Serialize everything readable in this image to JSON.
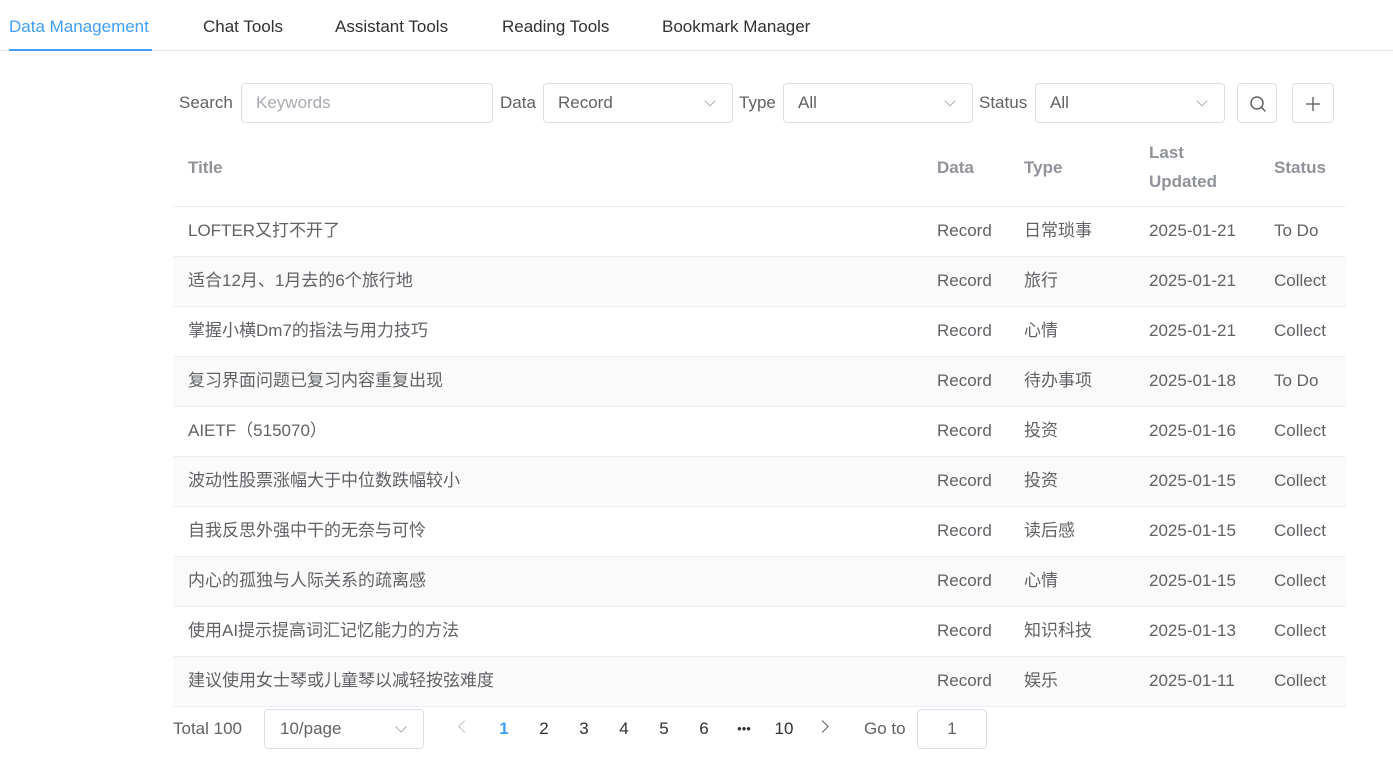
{
  "tabs": [
    {
      "label": "Data Management",
      "active": true
    },
    {
      "label": "Chat Tools",
      "active": false
    },
    {
      "label": "Assistant Tools",
      "active": false
    },
    {
      "label": "Reading Tools",
      "active": false
    },
    {
      "label": "Bookmark Manager",
      "active": false
    }
  ],
  "filters": {
    "search_label": "Search",
    "search_placeholder": "Keywords",
    "search_value": "",
    "data_label": "Data",
    "data_value": "Record",
    "type_label": "Type",
    "type_value": "All",
    "status_label": "Status",
    "status_value": "All",
    "search_button_icon": "search-icon",
    "add_button_icon": "plus-icon"
  },
  "table": {
    "columns": {
      "title": "Title",
      "data": "Data",
      "type": "Type",
      "updated_line1": "Last",
      "updated_line2": "Updated",
      "status": "Status"
    },
    "rows": [
      {
        "title": "LOFTER又打不开了",
        "data": "Record",
        "type": "日常琐事",
        "updated": "2025-01-21",
        "status": "To Do"
      },
      {
        "title": "适合12月、1月去的6个旅行地",
        "data": "Record",
        "type": "旅行",
        "updated": "2025-01-21",
        "status": "Collect"
      },
      {
        "title": "掌握小横Dm7的指法与用力技巧",
        "data": "Record",
        "type": "心情",
        "updated": "2025-01-21",
        "status": "Collect"
      },
      {
        "title": "复习界面问题已复习内容重复出现",
        "data": "Record",
        "type": "待办事项",
        "updated": "2025-01-18",
        "status": "To Do"
      },
      {
        "title": "AIETF（515070）",
        "data": "Record",
        "type": "投资",
        "updated": "2025-01-16",
        "status": "Collect"
      },
      {
        "title": "波动性股票涨幅大于中位数跌幅较小",
        "data": "Record",
        "type": "投资",
        "updated": "2025-01-15",
        "status": "Collect"
      },
      {
        "title": "自我反思外强中干的无奈与可怜",
        "data": "Record",
        "type": "读后感",
        "updated": "2025-01-15",
        "status": "Collect"
      },
      {
        "title": "内心的孤独与人际关系的疏离感",
        "data": "Record",
        "type": "心情",
        "updated": "2025-01-15",
        "status": "Collect"
      },
      {
        "title": "使用AI提示提高词汇记忆能力的方法",
        "data": "Record",
        "type": "知识科技",
        "updated": "2025-01-13",
        "status": "Collect"
      },
      {
        "title": "建议使用女士琴或儿童琴以减轻按弦难度",
        "data": "Record",
        "type": "娱乐",
        "updated": "2025-01-11",
        "status": "Collect"
      }
    ]
  },
  "pagination": {
    "total_text": "Total 100",
    "page_size": "10/page",
    "pages": [
      "1",
      "2",
      "3",
      "4",
      "5",
      "6",
      "•••",
      "10"
    ],
    "current_page": "1",
    "goto_label": "Go to",
    "goto_value": "1"
  },
  "colors": {
    "accent": "#409eff",
    "border": "#dcdfe6",
    "text": "#606266",
    "header_text": "#909399",
    "stripe": "#fafafa"
  }
}
